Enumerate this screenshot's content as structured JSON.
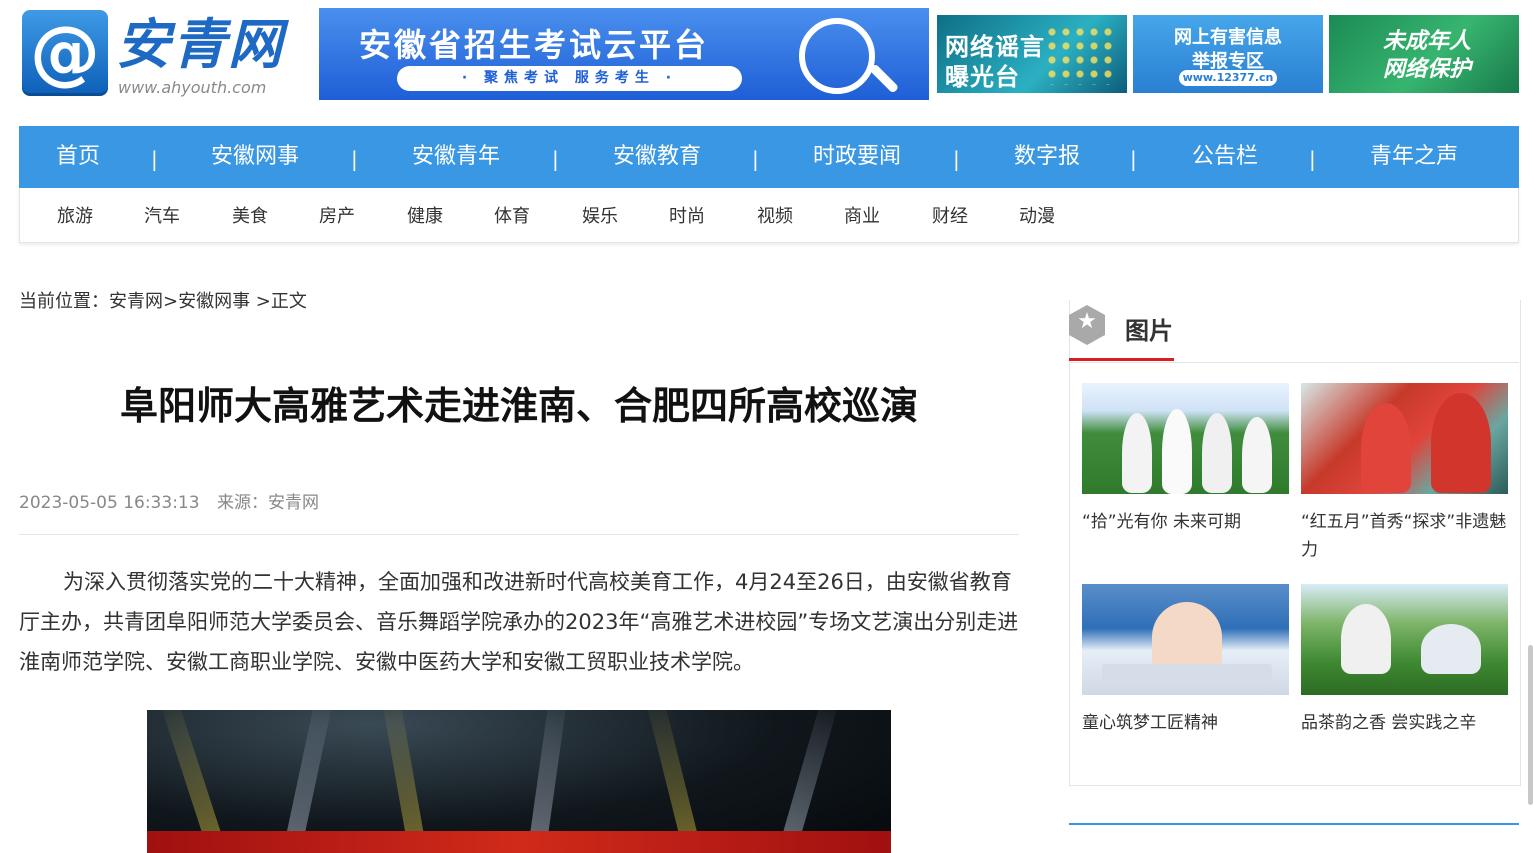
{
  "header": {
    "logo_mark": "@",
    "logo_text": "安青网",
    "logo_url": "www.ahyouth.com",
    "main_banner": {
      "title": "安徽省招生考试云平台",
      "subtitle": "· 聚焦考试 服务考生 ·"
    },
    "side_banners": [
      {
        "line1": "网络谣言",
        "line2": "曝光台"
      },
      {
        "line1": "网上有害信息",
        "line2": "举报专区",
        "extra": "www.12377.cn"
      },
      {
        "line1": "未成年人",
        "line2": "网络保护"
      }
    ]
  },
  "nav": {
    "main": [
      "首页",
      "安徽网事",
      "安徽青年",
      "安徽教育",
      "时政要闻",
      "数字报",
      "公告栏",
      "青年之声"
    ],
    "separator": "|",
    "sub": [
      "旅游",
      "汽车",
      "美食",
      "房产",
      "健康",
      "体育",
      "娱乐",
      "时尚",
      "视频",
      "商业",
      "财经",
      "动漫"
    ]
  },
  "breadcrumb": "当前位置：安青网>安徽网事 >正文",
  "article": {
    "title": "阜阳师大高雅艺术走进淮南、合肥四所高校巡演",
    "datetime": "2023-05-05 16:33:13",
    "source": "来源：安青网",
    "body": "为深入贯彻落实党的二十大精神，全面加强和改进新时代高校美育工作，4月24至26日，由安徽省教育厅主办，共青团阜阳师范大学委员会、音乐舞蹈学院承办的2023年“高雅艺术进校园”专场文艺演出分别走进淮南师范学院、安徽工商职业学院、安徽中医药大学和安徽工贸职业技术学院。"
  },
  "sidebar": {
    "title": "图片",
    "icon": "star-icon",
    "pictures": [
      {
        "caption": "“拾”光有你 未来可期"
      },
      {
        "caption": "“红五月”首秀“探求”非遗魅力"
      },
      {
        "caption": "童心筑梦工匠精神"
      },
      {
        "caption": "品茶韵之香 尝实践之辛"
      }
    ]
  },
  "colors": {
    "nav_blue": "#3a97e3",
    "accent_red": "#d81e1e",
    "logo_blue": "#1d69c4"
  }
}
